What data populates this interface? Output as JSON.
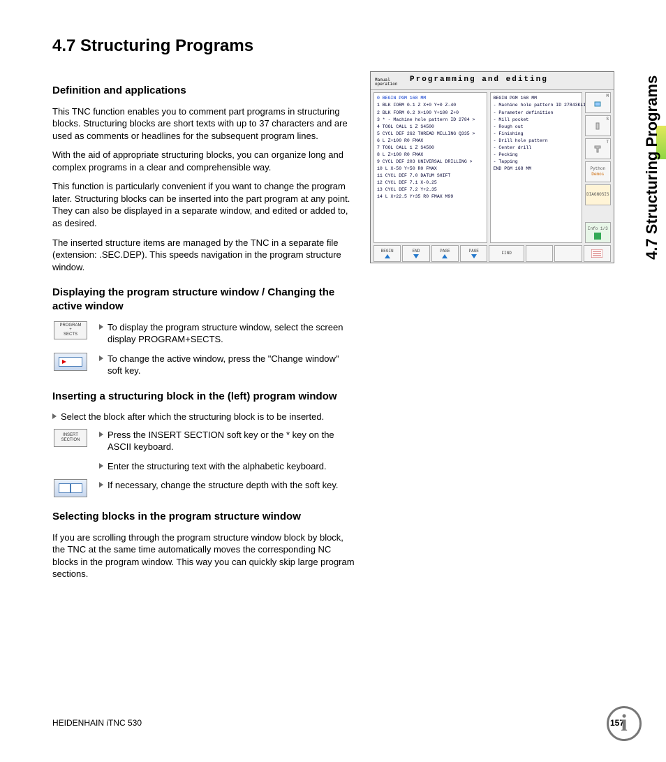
{
  "title": "4.7  Structuring Programs",
  "side_tab": "4.7 Structuring Programs",
  "sec1": {
    "heading": "Definition and applications",
    "p1": "This TNC function enables you to comment part programs in structuring blocks. Structuring blocks are short texts with up to 37 characters and are used as comments or headlines for the subsequent program lines.",
    "p2": "With the aid of appropriate structuring blocks, you can organize long and complex programs in a clear and comprehensible way.",
    "p3": "This function is particularly convenient if you want to change the program later. Structuring blocks can be inserted into the part program at any point. They can also be displayed in a separate window, and edited or added to, as desired.",
    "p4": "The inserted structure items are managed by the TNC in a separate file (extension: .SEC.DEP). This speeds navigation in the program structure window."
  },
  "sec2": {
    "heading": "Displaying the program structure window / Changing the active window",
    "key1": "PROGRAM\n+\nSECTS",
    "step1": "To display the program structure window, select the screen display PROGRAM+SECTS.",
    "step2": "To change the active window, press the \"Change window\" soft key."
  },
  "sec3": {
    "heading": "Inserting a structuring block in the (left) program window",
    "top": "Select the block after which the structuring block is to be inserted.",
    "key1": "INSERT\nSECTION",
    "step1": "Press the INSERT SECTION soft key or the * key on the ASCII keyboard.",
    "step2": "Enter the structuring text with the alphabetic keyboard.",
    "step3": "If necessary, change the structure depth with the soft key."
  },
  "sec4": {
    "heading": "Selecting blocks in the program structure window",
    "p1": "If you are scrolling through the program structure window block by block, the TNC at the same time automatically moves the corresponding NC blocks in the program window. This way you can quickly skip large program sections."
  },
  "screenshot": {
    "mode1": "Manual",
    "mode2": "operation",
    "title": "Programming and editing",
    "code": [
      "0  BEGIN PGM 168 MM",
      "1  BLK FORM 0.1 Z  X+0  Y+0  Z-40",
      "2  BLK FORM 0.2  X+100  Y+100  Z+0",
      "3  * - Machine hole pattern ID 2784 >",
      "4  TOOL CALL 1 Z S4500",
      "5  CYCL DEF 262 THREAD MILLING Q335 >",
      "6  L  Z+100 R0 FMAX",
      "7  TOOL CALL 1 Z S4500",
      "8  L  Z+100 R0 FMAX",
      "9  CYCL DEF 203 UNIVERSAL DRILLING  >",
      "10 L  X-50  Y+50 R0 FMAX",
      "11 CYCL DEF 7.0 DATUM SHIFT",
      "12 CYCL DEF 7.1  X-0.25",
      "13 CYCL DEF 7.2  Y+2.35",
      "14 L  X+22.5  Y+35 R0 FMAX M99"
    ],
    "struct": [
      "BEGIN PGM 168 MM",
      "- Machine hole pattern ID 27843KL1",
      "- Parameter definition",
      "- Mill pocket",
      "  - Rough out",
      "  - Finishing",
      "- Drill hole pattern",
      "  - Center drill",
      "  - Pecking",
      "  - Tapping",
      "END PGM 168 MM"
    ],
    "side": {
      "m": "M",
      "s": "S",
      "t": "T",
      "python": "Python",
      "demos": "Demos",
      "diag": "DIAGNOSIS",
      "info": "Info 1/3"
    },
    "footer": {
      "begin": "BEGIN",
      "end": "END",
      "pageu": "PAGE",
      "paged": "PAGE",
      "find": "FIND"
    }
  },
  "footer": {
    "left": "HEIDENHAIN iTNC 530",
    "page": "157"
  }
}
